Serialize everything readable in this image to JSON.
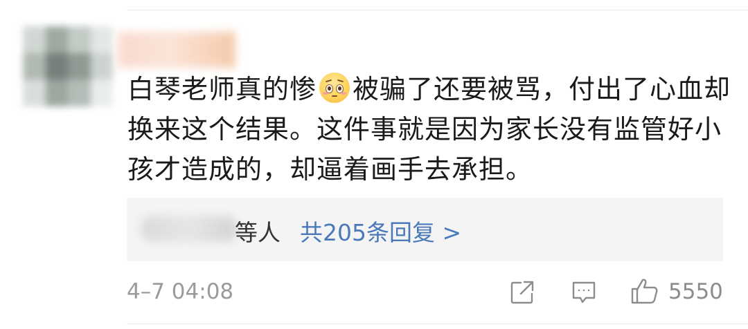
{
  "comment": {
    "text_before_emoji": "白琴老师真的惨",
    "emoji_name": "pleading-face-emoji",
    "text_after_emoji": "被骗了还要被骂，付出了心血却换来这个结果。这件事就是因为家长没有监管好小孩才造成的，却逼着画手去承担。"
  },
  "replies": {
    "suffix": "等人",
    "link_label": "共205条回复 >"
  },
  "footer": {
    "timestamp": "4–7 04:08",
    "like_count": "5550",
    "share_icon": "share-icon",
    "comment_icon": "comment-icon",
    "like_icon": "thumbs-up-icon"
  },
  "colors": {
    "link": "#4a79b9",
    "text": "#1a1a1a",
    "muted": "#9a9a9a",
    "reply_bg": "#f4f4f4"
  }
}
